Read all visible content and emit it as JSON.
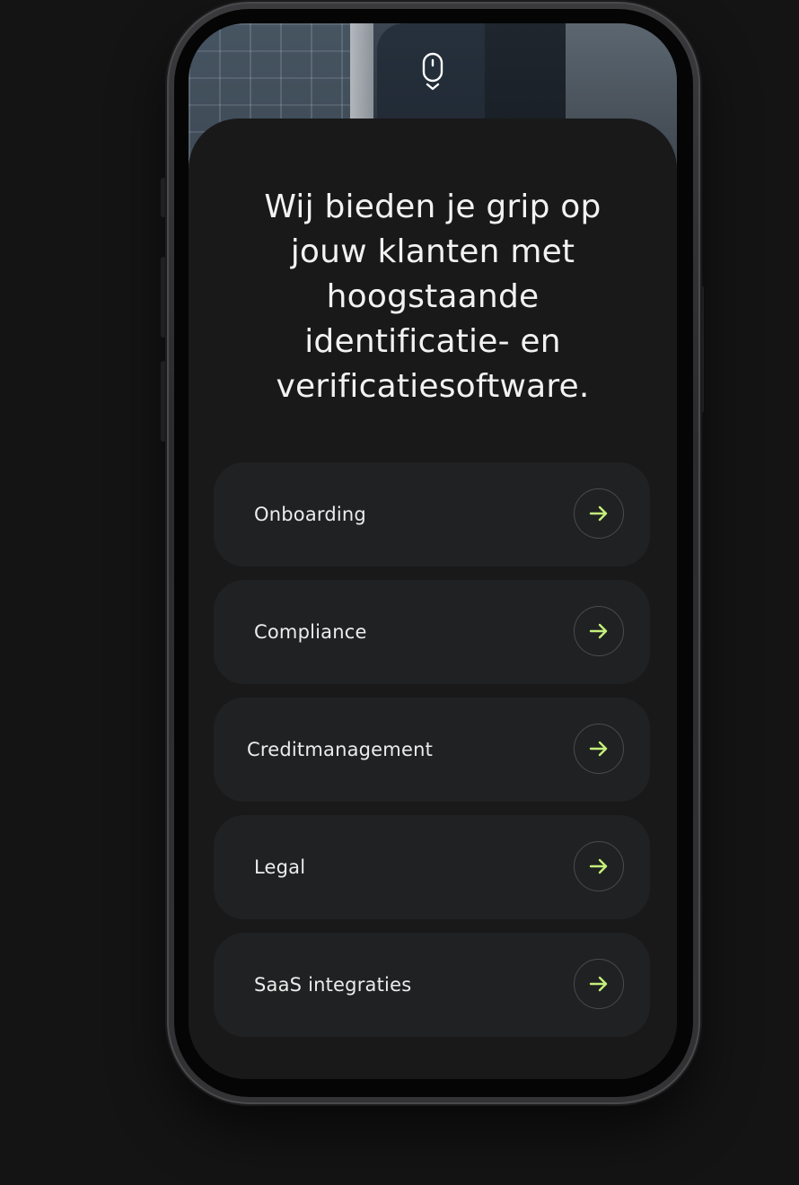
{
  "headline": "Wij bieden je grip op jouw klanten met hoogstaande identificatie- en verificatiesoftware.",
  "headline_lines": [
    "Wij bieden je grip op",
    "jouw klanten met",
    "hoogstaande",
    "identificatie- en",
    "verificatiesoftware."
  ],
  "menu": {
    "items": [
      {
        "label": "Onboarding",
        "icon": "arrow-right-icon"
      },
      {
        "label": "Compliance",
        "icon": "arrow-right-icon"
      },
      {
        "label": "Creditmanagement",
        "icon": "arrow-right-icon"
      },
      {
        "label": "Legal",
        "icon": "arrow-right-icon"
      },
      {
        "label": "SaaS integraties",
        "icon": "arrow-right-icon"
      }
    ]
  },
  "icons": {
    "scroll_indicator": "scroll-mouse-icon"
  },
  "colors": {
    "background": "#141415",
    "screen_card": "#19191a",
    "menu_item": "#202122",
    "accent_arrow": "#c3f07a",
    "text": "#f2f2f2"
  }
}
